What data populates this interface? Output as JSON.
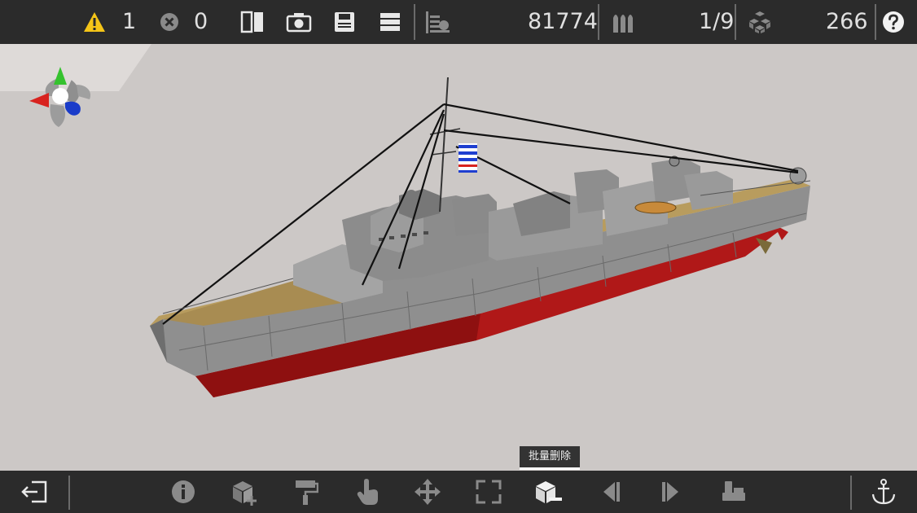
{
  "top": {
    "warning_count": "1",
    "error_count": "0",
    "part_count": "81774",
    "layer_value": "1/9",
    "block_count": "266"
  },
  "tooltip": {
    "label": "批量删除"
  },
  "colors": {
    "bar": "#2b2b2b",
    "icon": "#e8e8e8",
    "icon_dim": "#8a8a8a",
    "warning": "#f5c518",
    "viewport": "#ccc8c6",
    "hull_red": "#b01818",
    "deck_tan": "#b89c5e",
    "hull_gray": "#8f8f8f"
  },
  "icons": {
    "top": [
      "warning-icon",
      "error-icon",
      "split-view-icon",
      "camera-icon",
      "save-icon",
      "layers-icon",
      "weight-icon",
      "ammo-icon",
      "blocks-icon",
      "help-icon"
    ],
    "bottom": [
      "exit-icon",
      "info-icon",
      "add-block-icon",
      "paint-roller-icon",
      "touch-icon",
      "move-icon",
      "resize-icon",
      "batch-delete-icon",
      "prev-icon",
      "next-icon",
      "sofa-icon",
      "anchor-icon"
    ]
  }
}
